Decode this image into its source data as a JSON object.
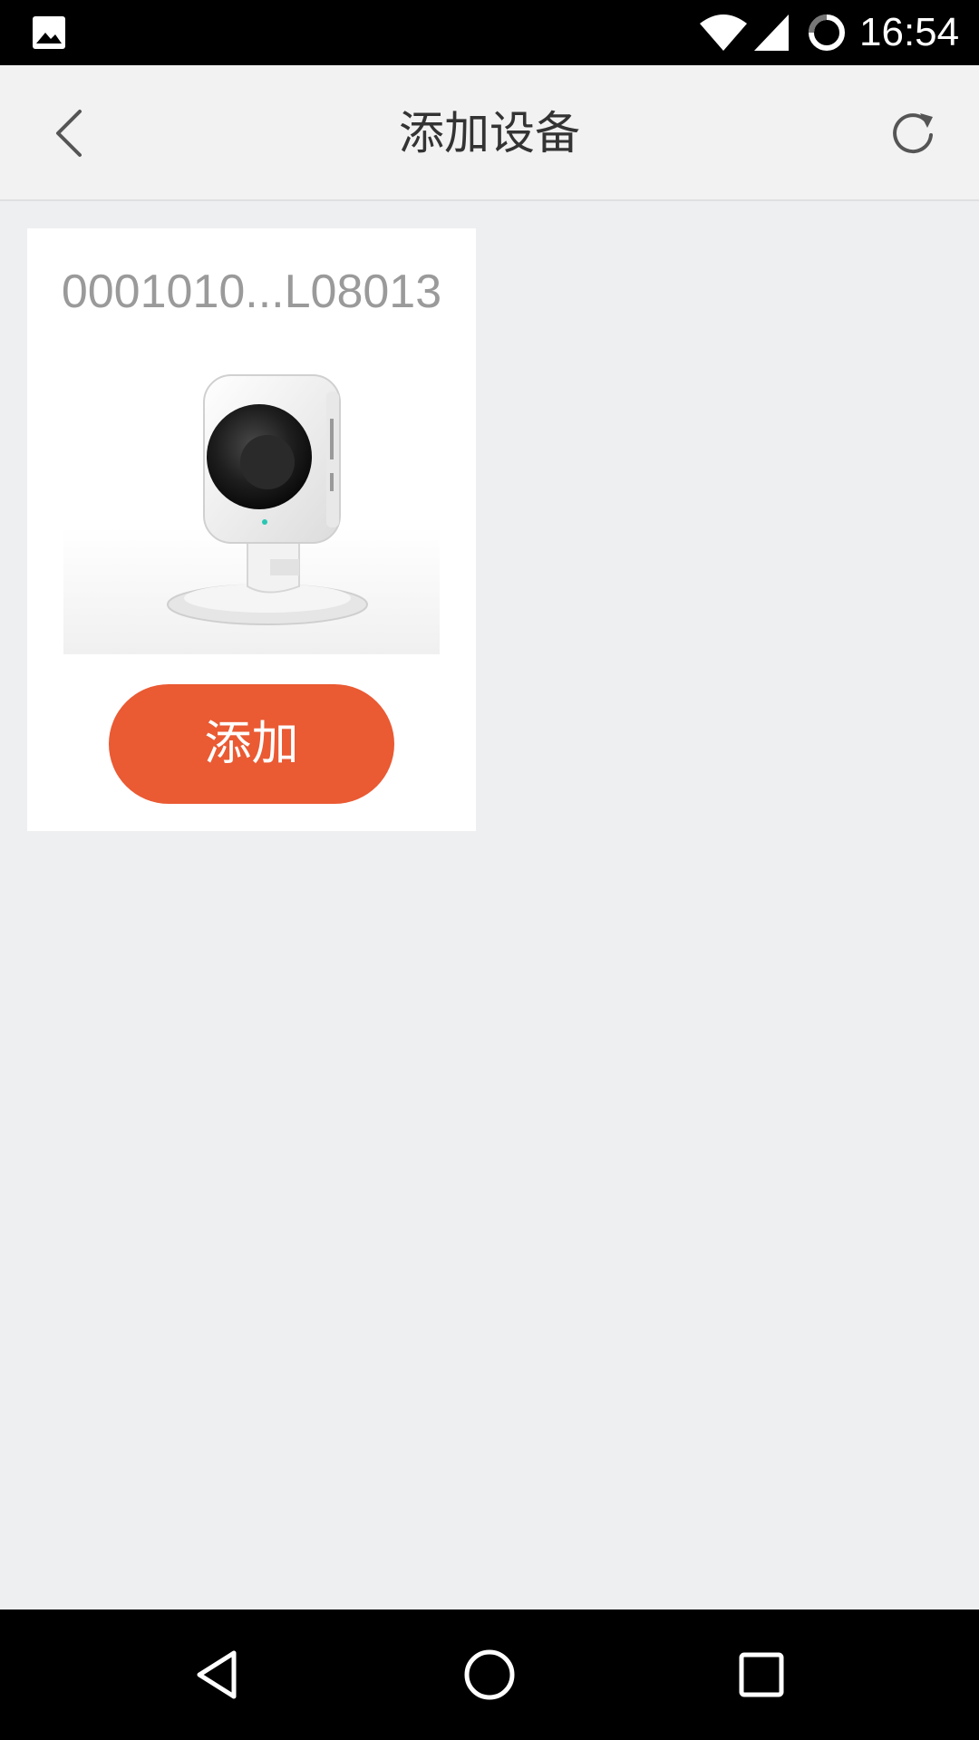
{
  "status_bar": {
    "time": "16:54",
    "icons": [
      "gallery-icon",
      "wifi-icon",
      "signal-icon",
      "sync-icon"
    ]
  },
  "app_bar": {
    "title": "添加设备",
    "back_icon": "back-chevron-icon",
    "refresh_icon": "refresh-icon"
  },
  "device_card": {
    "name": "0001010...L08013",
    "image": "camera-image",
    "add_label": "添加"
  },
  "nav_bar": {
    "icons": [
      "back-triangle-icon",
      "home-circle-icon",
      "recents-square-icon"
    ]
  },
  "colors": {
    "accent": "#ea5a33",
    "background": "#eeeff1",
    "app_bar": "#f2f2f2",
    "card": "#ffffff",
    "device_name_text": "#9a9a9a"
  }
}
